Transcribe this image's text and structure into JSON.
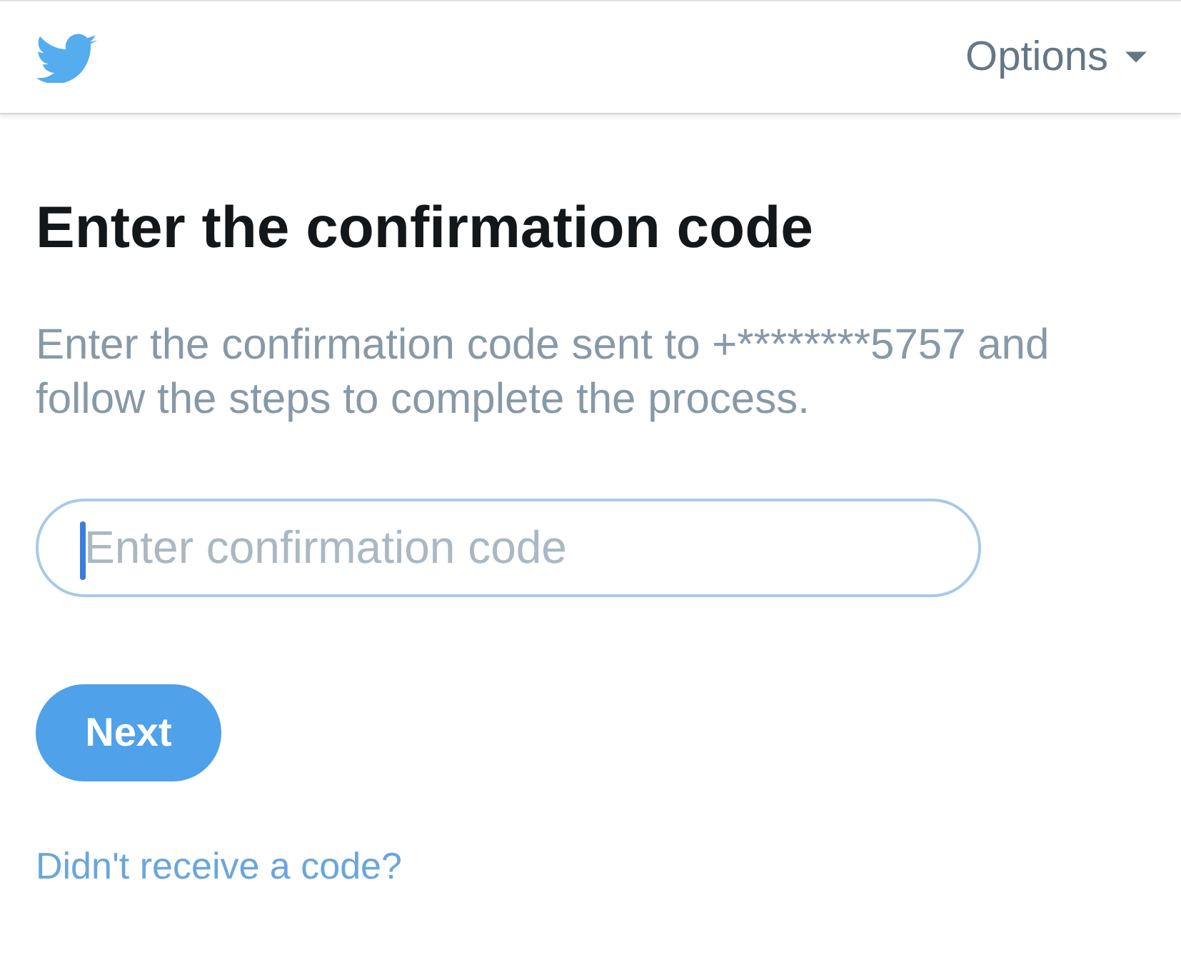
{
  "header": {
    "options_menu": {
      "label": "Options"
    }
  },
  "title": "Enter the confirmation code",
  "description": "Enter the confirmation code sent to +********5757 and follow the steps to complete the process.",
  "code_field": {
    "placeholder": "Enter confirmation code",
    "focused": true
  },
  "next_button": {
    "label": "Next"
  },
  "help_link": {
    "label": "Didn't receive a code?"
  }
}
